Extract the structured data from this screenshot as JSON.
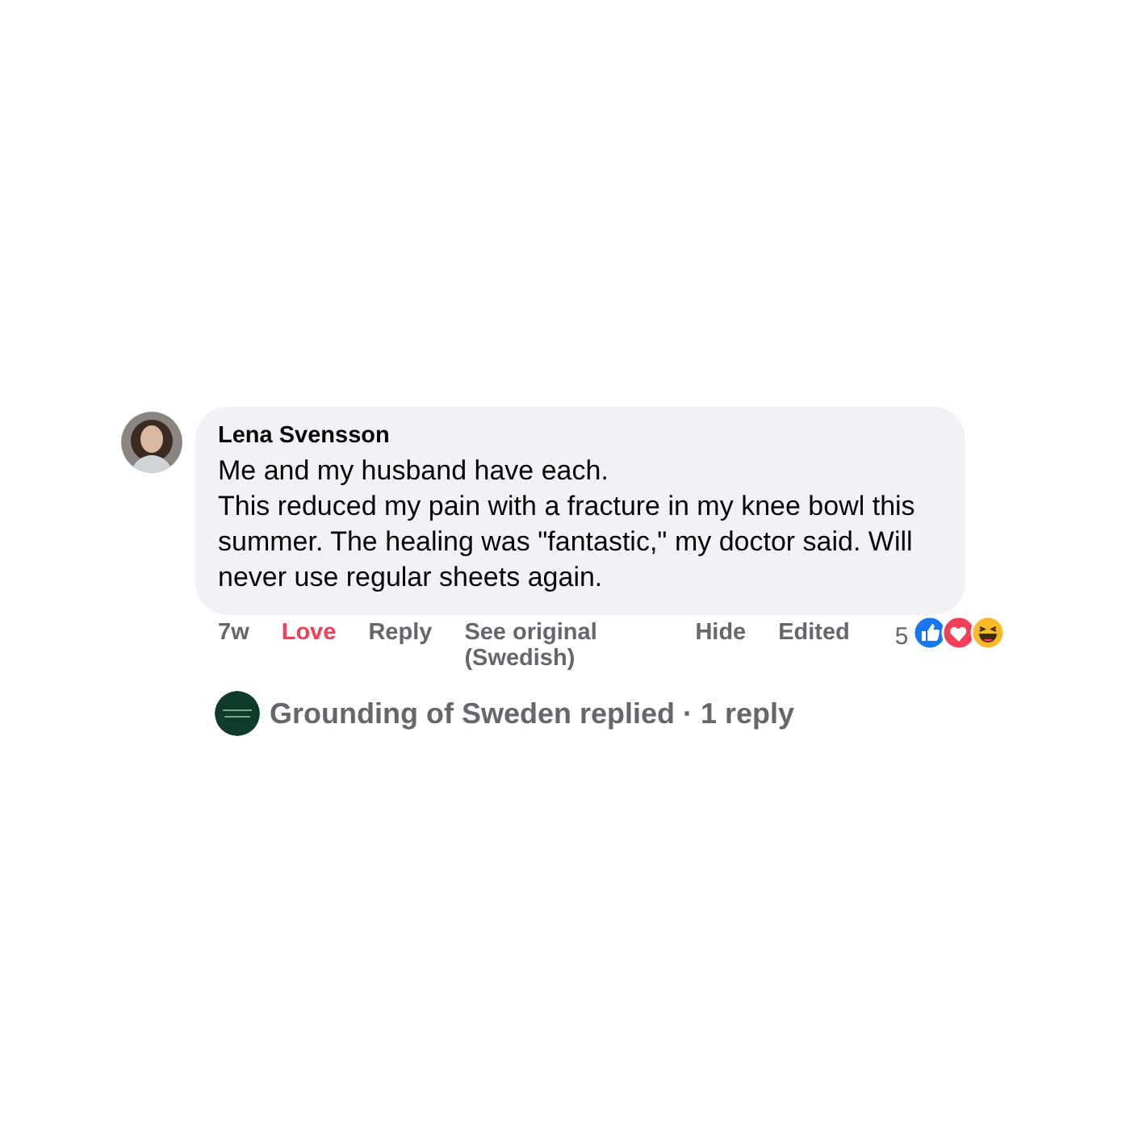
{
  "comment": {
    "author": "Lena Svensson",
    "paragraphs": [
      "Me and my husband have each.",
      "This reduced my pain with a fracture in my knee bowl this summer. The healing was \"fantastic,\" my doctor said. Will never use regular sheets again."
    ],
    "time": "7w",
    "reaction": {
      "label": "Love",
      "active": true
    },
    "actions": [
      {
        "label": "Reply"
      },
      {
        "label": "See original (Swedish)"
      },
      {
        "label": "Hide"
      },
      {
        "label": "Edited"
      }
    ],
    "reaction_count": "5",
    "reaction_icons": [
      {
        "kind": "like"
      },
      {
        "kind": "love"
      },
      {
        "kind": "haha"
      }
    ],
    "replies": {
      "text": "Grounding of Sweden replied · 1 reply"
    }
  }
}
